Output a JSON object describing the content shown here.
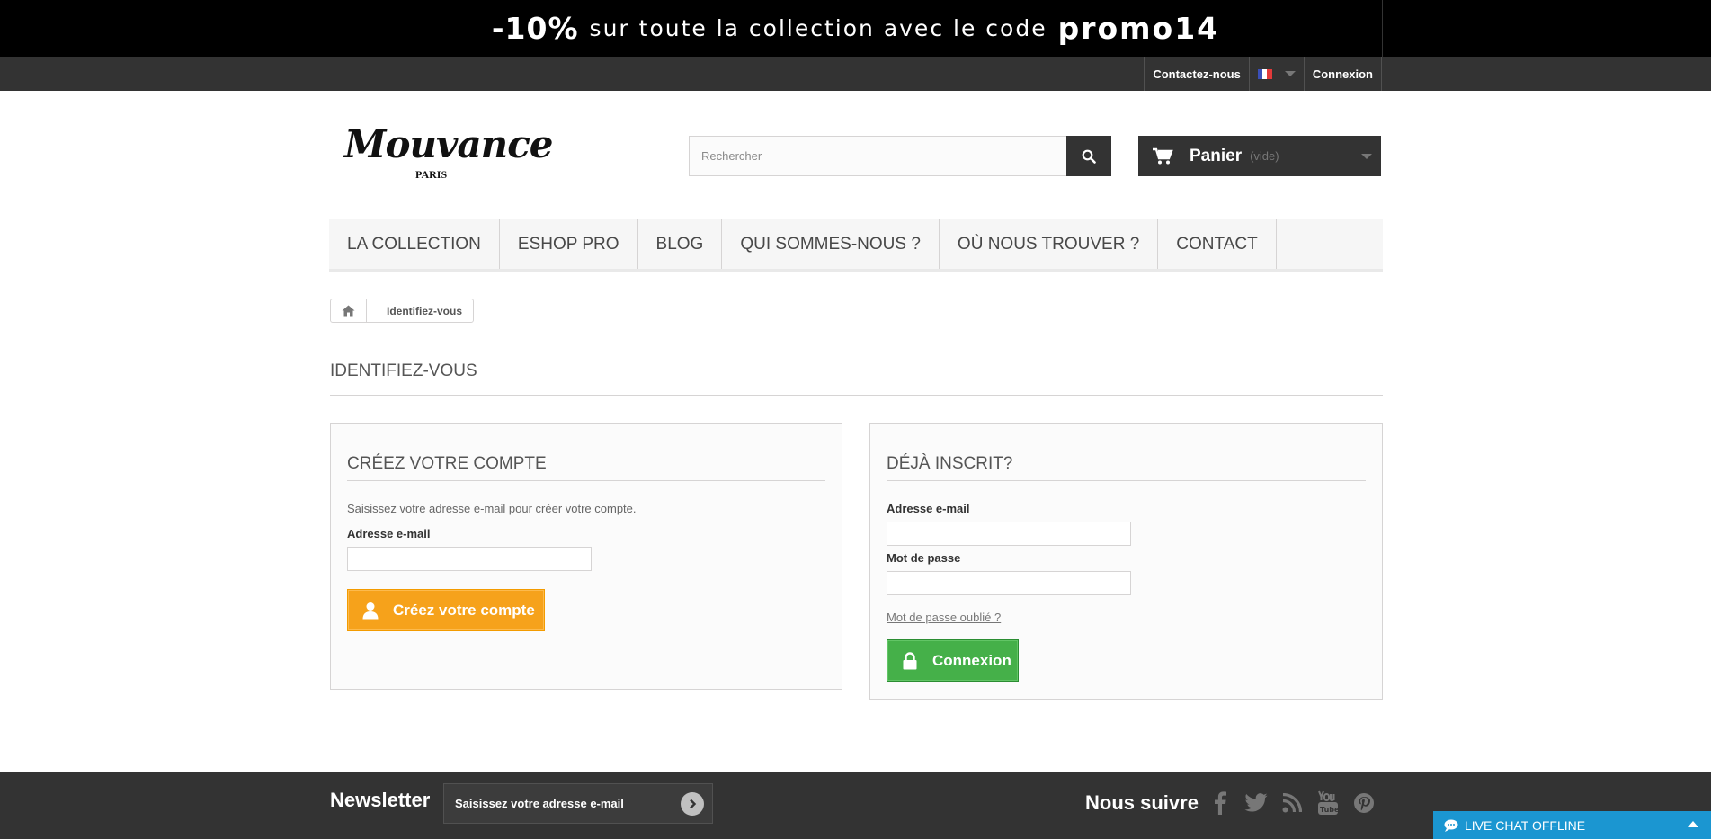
{
  "promo": {
    "discount": "-10%",
    "text": "sur toute la collection avec le code",
    "code": "promo14"
  },
  "topbar": {
    "contact": "Contactez-nous",
    "login": "Connexion"
  },
  "logo": {
    "name": "Mouvance",
    "sub": "PARIS"
  },
  "search": {
    "placeholder": "Rechercher"
  },
  "cart": {
    "title": "Panier",
    "status": "(vide)"
  },
  "menu": {
    "items": [
      {
        "label": "LA COLLECTION"
      },
      {
        "label": "ESHOP PRO"
      },
      {
        "label": "BLOG"
      },
      {
        "label": "QUI SOMMES-NOUS ?"
      },
      {
        "label": "OÙ NOUS TROUVER ?"
      },
      {
        "label": "CONTACT"
      }
    ]
  },
  "breadcrumb": {
    "current": "Identifiez-vous"
  },
  "page": {
    "title": "IDENTIFIEZ-VOUS"
  },
  "create": {
    "title": "CRÉEZ VOTRE COMPTE",
    "hint": "Saisissez votre adresse e-mail pour créer votre compte.",
    "email_label": "Adresse e-mail",
    "button": "Créez votre compte"
  },
  "login": {
    "title": "DÉJÀ INSCRIT?",
    "email_label": "Adresse e-mail",
    "password_label": "Mot de passe",
    "forgot": "Mot de passe oublié ?",
    "button": "Connexion"
  },
  "footer": {
    "newsletter_title": "Newsletter",
    "newsletter_placeholder": "Saisissez votre adresse e-mail",
    "follow_title": "Nous suivre",
    "socials": [
      "facebook-icon",
      "twitter-icon",
      "rss-icon",
      "youtube-icon",
      "pinterest-icon"
    ]
  },
  "livechat": {
    "label": "LIVE CHAT OFFLINE"
  },
  "colors": {
    "orange": "#f6a21b",
    "green": "#45b049",
    "dark": "#333333",
    "chat": "#1b96d1"
  }
}
